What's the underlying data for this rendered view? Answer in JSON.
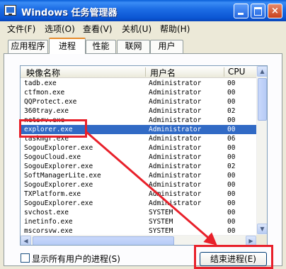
{
  "window": {
    "title": "Windows 任务管理器",
    "buttons": {
      "minimize": "minimize-icon",
      "maximize": "maximize-icon",
      "close": "×"
    }
  },
  "menu": [
    "文件(F)",
    "选项(O)",
    "查看(V)",
    "关机(U)",
    "帮助(H)"
  ],
  "tabs": [
    "应用程序",
    "进程",
    "性能",
    "联网",
    "用户"
  ],
  "active_tab": "进程",
  "columns": {
    "name": "映像名称",
    "user": "用户名",
    "cpu": "CPU"
  },
  "processes": [
    {
      "name": "tadb.exe",
      "user": "Administrator",
      "cpu": "00"
    },
    {
      "name": "ctfmon.exe",
      "user": "Administrator",
      "cpu": "00"
    },
    {
      "name": "QQProtect.exe",
      "user": "Administrator",
      "cpu": "00"
    },
    {
      "name": "360tray.exe",
      "user": "Administrator",
      "cpu": "02"
    },
    {
      "name": "netsrv.exe",
      "user": "Administrator",
      "cpu": "00"
    },
    {
      "name": "explorer.exe",
      "user": "Administrator",
      "cpu": "00"
    },
    {
      "name": "taskmgr.exe",
      "user": "Administrator",
      "cpu": "06"
    },
    {
      "name": "SogouExplorer.exe",
      "user": "Administrator",
      "cpu": "00"
    },
    {
      "name": "SogouCloud.exe",
      "user": "Administrator",
      "cpu": "00"
    },
    {
      "name": "SogouExplorer.exe",
      "user": "Administrator",
      "cpu": "02"
    },
    {
      "name": "SoftManagerLite.exe",
      "user": "Administrator",
      "cpu": "00"
    },
    {
      "name": "SogouExplorer.exe",
      "user": "Administrator",
      "cpu": "00"
    },
    {
      "name": "TXPlatform.exe",
      "user": "Administrator",
      "cpu": "00"
    },
    {
      "name": "SogouExplorer.exe",
      "user": "Administrator",
      "cpu": "00"
    },
    {
      "name": "svchost.exe",
      "user": "SYSTEM",
      "cpu": "00"
    },
    {
      "name": "inetinfo.exe",
      "user": "SYSTEM",
      "cpu": "00"
    },
    {
      "name": "mscorsvw.exe",
      "user": "SYSTEM",
      "cpu": "00"
    }
  ],
  "selected_process": "explorer.exe",
  "show_all_users": {
    "label": "显示所有用户的进程(S)",
    "checked": false
  },
  "end_process_button": "结束进程(E)",
  "annotation_color": "#e8202a",
  "selection_color": "#316ac5"
}
